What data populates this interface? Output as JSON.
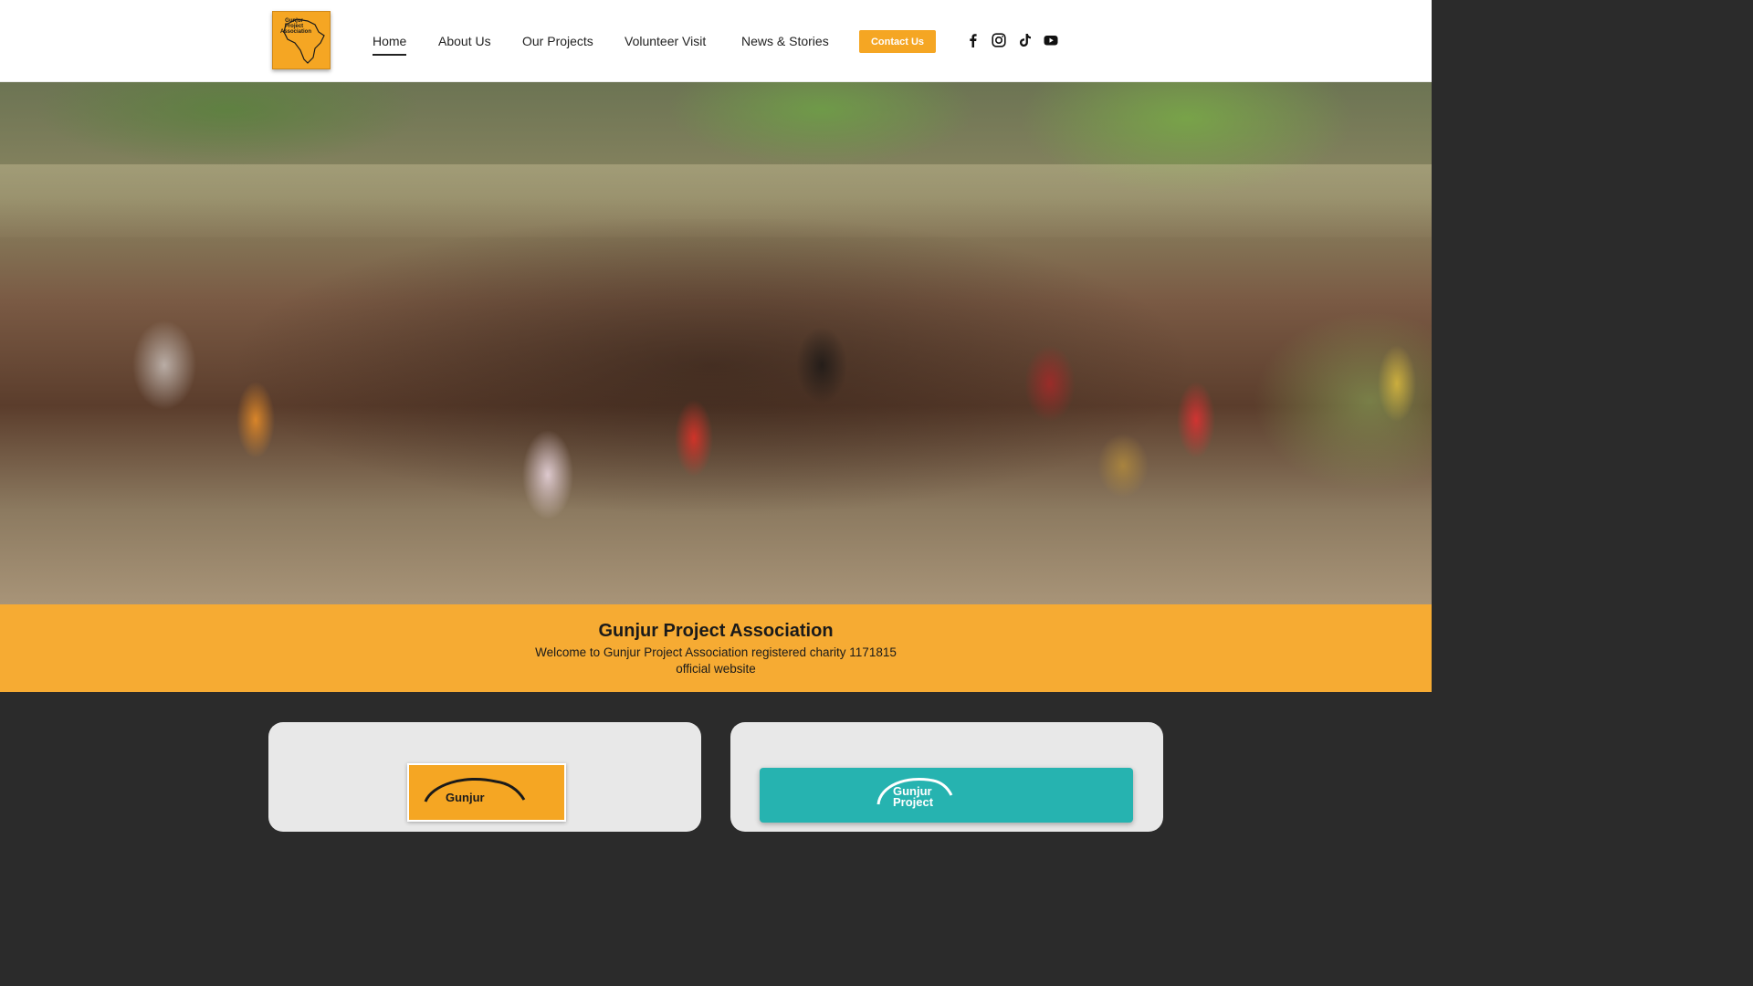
{
  "header": {
    "logo_alt": "Gunjur Project Association",
    "logo_lines": [
      "Gunjur",
      "Project",
      "Association"
    ],
    "nav": [
      {
        "label": "Home",
        "active": true
      },
      {
        "label": "About Us",
        "active": false
      },
      {
        "label": "Our Projects",
        "active": false
      },
      {
        "label": "Volunteer Visit",
        "active": false
      },
      {
        "label": "News & Stories",
        "active": false
      }
    ],
    "contact_label": "Contact Us",
    "social_icons": [
      "facebook-icon",
      "instagram-icon",
      "tiktok-icon",
      "youtube-icon"
    ]
  },
  "hero": {
    "image": "group-photo-children-waving"
  },
  "banner": {
    "title": "Gunjur Project Association",
    "subtitle": "Welcome to Gunjur Project Association registered charity 1171815 official website"
  },
  "cards": [
    {
      "image_text": "Gunjur"
    },
    {
      "image_text_1": "Gunjur",
      "image_text_2": "Project"
    }
  ],
  "colors": {
    "brand_orange": "#f6ab33",
    "dark_section": "#2b2b2b",
    "teal": "#26b3b0"
  }
}
